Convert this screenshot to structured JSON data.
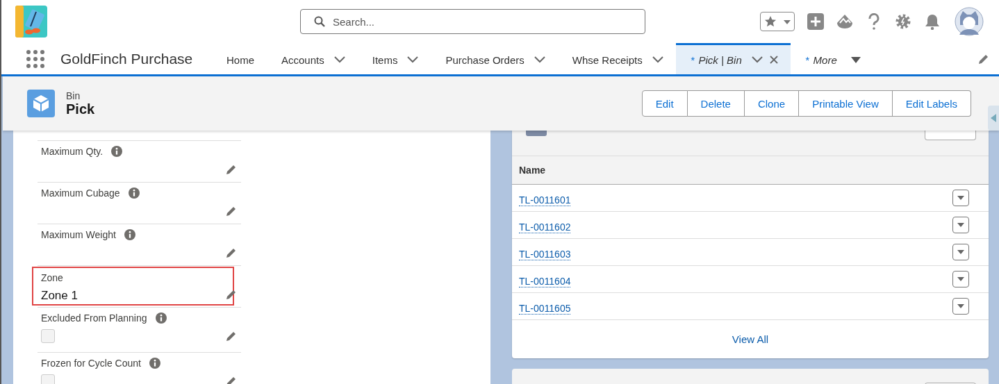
{
  "search": {
    "placeholder": "Search..."
  },
  "app": {
    "name": "GoldFinch Purchase"
  },
  "tabs": [
    {
      "label": "Home",
      "kind": "plain",
      "selected": false,
      "closable": false
    },
    {
      "label": "Accounts",
      "kind": "chevron",
      "selected": false,
      "closable": false
    },
    {
      "label": "Items",
      "kind": "chevron",
      "selected": false,
      "closable": false
    },
    {
      "label": "Purchase Orders",
      "kind": "chevron",
      "selected": false,
      "closable": false
    },
    {
      "label": "Whse Receipts",
      "kind": "chevron",
      "selected": false,
      "closable": false
    },
    {
      "label": "Pick | Bin",
      "prefix": "*",
      "kind": "chevron",
      "selected": true,
      "closable": true
    },
    {
      "label": "More",
      "prefix": "*",
      "kind": "triangle",
      "selected": false,
      "closable": false
    }
  ],
  "record": {
    "type": "Bin",
    "name": "Pick"
  },
  "actions": [
    "Edit",
    "Delete",
    "Clone",
    "Printable View",
    "Edit Labels"
  ],
  "fields": [
    {
      "kind": "text",
      "label": "Maximum Qty.",
      "info": true,
      "highlighted": false
    },
    {
      "kind": "text",
      "label": "Maximum Cubage",
      "info": true,
      "highlighted": false
    },
    {
      "kind": "text",
      "label": "Maximum Weight",
      "info": true,
      "highlighted": false
    },
    {
      "kind": "text",
      "label": "Zone",
      "info": false,
      "value": "Zone 1",
      "highlighted": true
    },
    {
      "kind": "checkbox",
      "label": "Excluded From Planning",
      "info": true,
      "checked": false,
      "highlighted": false
    },
    {
      "kind": "checkbox",
      "label": "Frozen for Cycle Count",
      "info": true,
      "checked": false,
      "highlighted": false
    }
  ],
  "related": {
    "columns": [
      "Name"
    ],
    "rows": [
      "TL-0011601",
      "TL-0011602",
      "TL-0011603",
      "TL-0011604",
      "TL-0011605"
    ],
    "view_all": "View All"
  }
}
